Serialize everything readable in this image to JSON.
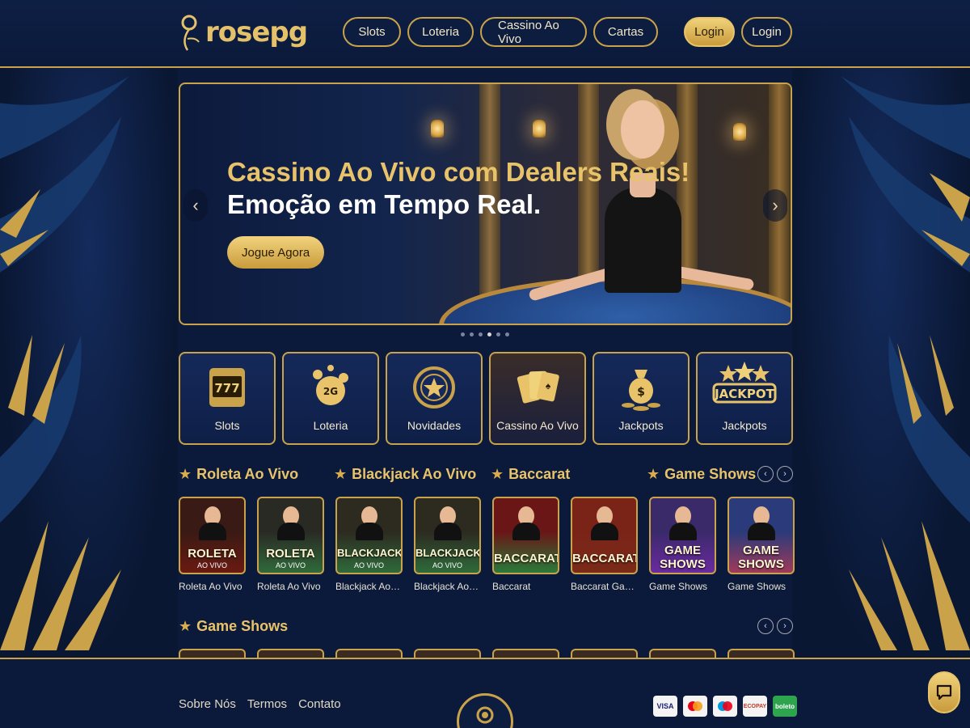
{
  "brand": {
    "logo_text": "rosepg"
  },
  "nav": [
    {
      "label": "Slots"
    },
    {
      "label": "Loteria"
    },
    {
      "label": "Cassino Ao Vivo"
    },
    {
      "label": "Cartas"
    }
  ],
  "auth": {
    "primary_label": "Login",
    "secondary_label": "Login"
  },
  "banner": {
    "title_line1": "Cassino Ao Vivo com Dealers Reais!",
    "title_line2": "Emoção em Tempo Real.",
    "cta_label": "Jogue Agora",
    "prev_icon": "chevron-left-icon",
    "next_icon": "chevron-right-icon",
    "slide_count": 6,
    "active_slide": 4
  },
  "categories": [
    {
      "label": "Slots",
      "icon": "slot-777-icon"
    },
    {
      "label": "Loteria",
      "icon": "lottery-balls-icon",
      "ball_text": "2G"
    },
    {
      "label": "Novidades",
      "icon": "star-chip-icon"
    },
    {
      "label": "Cassino Ao Vivo",
      "icon": "playing-cards-icon"
    },
    {
      "label": "Jackpots",
      "icon": "money-bag-icon"
    },
    {
      "label": "Jackpots",
      "icon": "jackpot-badge-icon",
      "badge_text": "JACKPOT"
    }
  ],
  "sections": {
    "live": [
      {
        "title": "Roleta Ao Vivo"
      },
      {
        "title": "Blackjack Ao Vivo"
      },
      {
        "title": "Baccarat"
      },
      {
        "title": "Game Shows"
      }
    ],
    "second": {
      "title": "Game Shows"
    }
  },
  "games": [
    {
      "thumb_title": "ROLETA",
      "thumb_sub": "AO VIVO",
      "caption": "Roleta Ao Vivo",
      "bg": "#3a1a14",
      "felt": "#6a1a12"
    },
    {
      "thumb_title": "ROLETA",
      "thumb_sub": "AO VIVO",
      "caption": "Roleta Ao Vivo",
      "bg": "#2a2a24",
      "felt": "#2f6a3a"
    },
    {
      "thumb_title": "BLACKJACK",
      "thumb_sub": "AO VIVO",
      "caption": "Blackjack Ao Vivo",
      "bg": "#2d2a20",
      "felt": "#2e6a3a"
    },
    {
      "thumb_title": "BLACKJACK",
      "thumb_sub": "AO VIVO",
      "caption": "Blackjack Ao Vivo",
      "bg": "#2d2a20",
      "felt": "#2e6a3a"
    },
    {
      "thumb_title": "BACCARAT",
      "thumb_sub": "",
      "caption": "Baccarat",
      "bg": "#6a1616",
      "felt": "#2a7a3a"
    },
    {
      "thumb_title": "BACCARAT",
      "thumb_sub": "",
      "caption": "Baccarat Game ...",
      "bg": "#7a2418",
      "felt": "#7a2a18"
    },
    {
      "thumb_title": "GAME SHOWS",
      "thumb_sub": "",
      "caption": "Game Shows",
      "bg": "#3a2a6a",
      "felt": "#6a2aa0"
    },
    {
      "thumb_title": "GAME SHOWS",
      "thumb_sub": "",
      "caption": "Game Shows",
      "bg": "#2a3a7a",
      "felt": "#a03a5a"
    }
  ],
  "footer": {
    "links": [
      {
        "label": "Sobre Nós"
      },
      {
        "label": "Termos"
      },
      {
        "label": "Contato"
      }
    ],
    "payments": [
      {
        "label": "VISA",
        "color": "#1a1f71"
      },
      {
        "label": "",
        "color": "#eb001b",
        "icon": "mastercard-icon"
      },
      {
        "label": "",
        "color": "#0099df",
        "icon": "maestro-icon"
      },
      {
        "label": "ECOPAY",
        "color": "#c0392b"
      },
      {
        "label": "boleto",
        "color": "#2ea44f"
      }
    ]
  },
  "chat": {
    "icon": "chat-bubble-icon"
  },
  "colors": {
    "gold": "#c9a24a",
    "navy": "#0b1a3a",
    "gold_light": "#e8c36a"
  }
}
